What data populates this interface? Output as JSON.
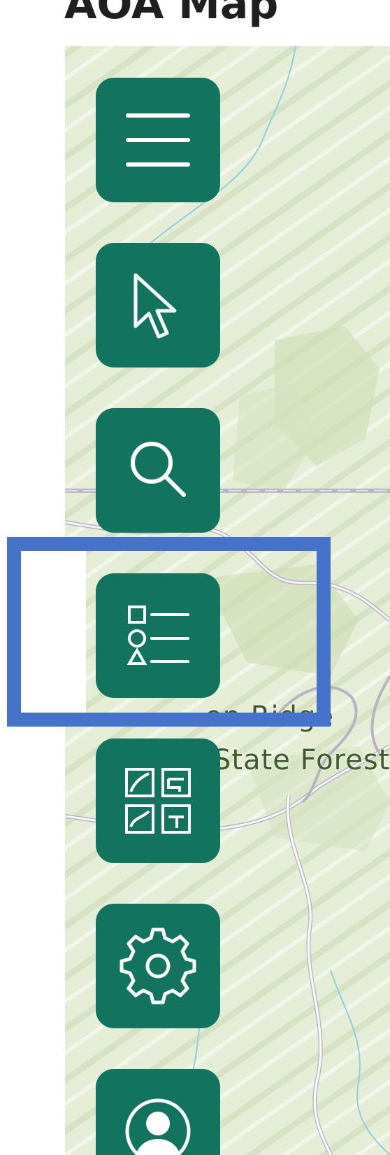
{
  "page": {
    "title": "AOA Map"
  },
  "map": {
    "labels": {
      "line1": "Tuscarora? Green Ridge",
      "line1_visible": "en Ridge",
      "line2": "State Forest"
    }
  },
  "toolbar": {
    "buttons": [
      {
        "name": "menu-button",
        "icon": "hamburger-menu-icon"
      },
      {
        "name": "select-button",
        "icon": "pointer-cursor-icon"
      },
      {
        "name": "search-button",
        "icon": "search-icon"
      },
      {
        "name": "legend-button",
        "icon": "legend-list-icon",
        "highlighted": true
      },
      {
        "name": "layers-button",
        "icon": "basemap-gallery-icon"
      },
      {
        "name": "settings-button",
        "icon": "gear-icon"
      },
      {
        "name": "account-button",
        "icon": "user-avatar-icon"
      }
    ]
  },
  "colors": {
    "button_bg": "#12735f",
    "icon_stroke": "#ffffff",
    "highlight": "#4673c9",
    "map_bg": "#e7eed8"
  }
}
